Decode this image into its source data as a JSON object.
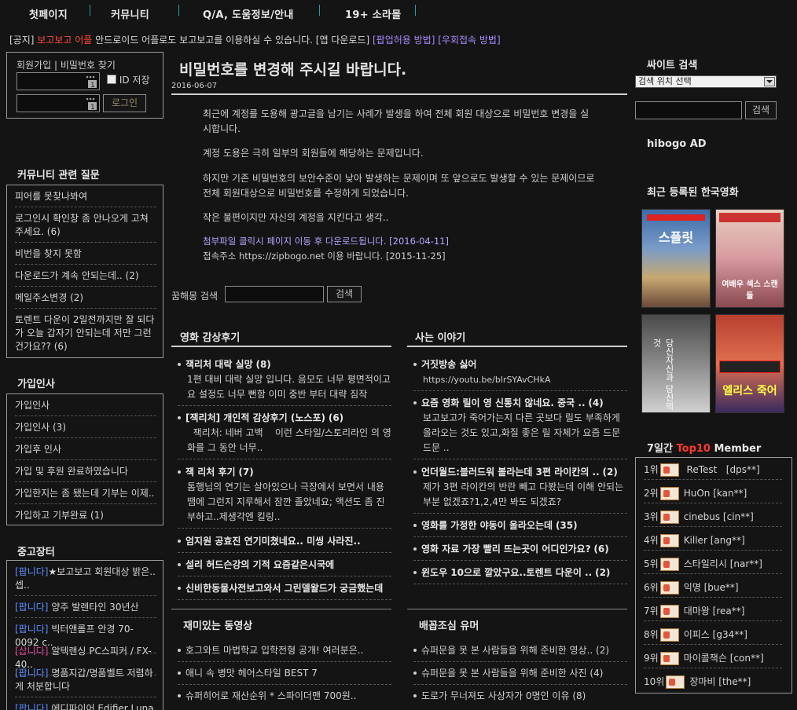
{
  "nav": {
    "items": [
      "첫페이지",
      "커뮤니티",
      "Q/A, 도움정보/안내",
      "19+ 소라몰"
    ]
  },
  "notice": {
    "prefix": "[공지]",
    "highlight": "보고보고 어플",
    "text": " 안드로이드 어플로도 보고보고를 이용하실 수 있습니다. [앱 다운로드] ",
    "link1": "[팝업허용 방법]",
    "link2": "[우회접속 방법]"
  },
  "login": {
    "signup": "회원가입",
    "divider": "|",
    "find_pw": "비밀번호 찾기",
    "save_id": "ID 저장",
    "login_btn": "로그인"
  },
  "community": {
    "title": "커뮤니티 관련 질문",
    "items": [
      {
        "text": "피어를 못찾나봐여",
        "count": ""
      },
      {
        "text": "로그인시 확인창 좀 안나오게 고쳐주세요.",
        "count": "(6)"
      },
      {
        "text": "비번을 찾지 못함",
        "count": ""
      },
      {
        "text": "다운로드가 계속 안되는데..",
        "count": "(2)"
      },
      {
        "text": "메일주소변경",
        "count": "(2)"
      },
      {
        "text": "토렌트 다운이 2일전까지만 잘 되다가 오늘 갑자기 안되는데 저만 그런건가요??",
        "count": "(6)"
      }
    ]
  },
  "greetings": {
    "title": "가입인사",
    "items": [
      {
        "text": "가입인사",
        "count": ""
      },
      {
        "text": "가입인사",
        "count": "(3)"
      },
      {
        "text": "가입후 인사",
        "count": ""
      },
      {
        "text": "가입 및 후원 완료하였습니다",
        "count": ""
      },
      {
        "text": "가입한지는 좀 됐는데 기부는 이제..",
        "count": ""
      },
      {
        "text": "가입하고 기부완료",
        "count": "(1)"
      }
    ]
  },
  "market": {
    "title": "중고장터",
    "items": [
      {
        "tag": "[팝니다]",
        "text": "★보고보고 회원대상 밝은.. 셉..",
        "tagcolor": "blue"
      },
      {
        "tag": "[팝니다]",
        "text": "양주 발렌타인 30년산",
        "tagcolor": "blue"
      },
      {
        "tag": "[팝니다]",
        "text": "빅터앤롤프 안경 70-0092 c..",
        "tagcolor": "blue"
      },
      {
        "tag": "[삽니다]",
        "text": "알텍랜싱 PC스피커 / FX-40..",
        "tagcolor": "magenta"
      },
      {
        "tag": "[팝니다]",
        "text": "명품지갑/명품벨트 저렴하게 처분합니다",
        "tagcolor": "blue"
      },
      {
        "tag": "[팝니다]",
        "text": "에디파이어 Edifier Luna",
        "tagcolor": "blue"
      }
    ]
  },
  "article": {
    "title": "비밀번호를 변경해 주시길 바랍니다.",
    "date": "2016-06-07",
    "p1": "최근에 계정를 도용해 광고글을 남기는 사례가 발생을 하여 전체 회원 대상으로 비밀번호 변경을 실시합니다.",
    "p2": "계정 도용은 극히 일부의 회원들에 해당하는 문제입니다.",
    "p3": "하지만 기존 비밀번호의 보안수준이 낮아 발생하는 문제이며 또 앞으로도 발생할 수 있는 문제이므로 전체 회원대상으로 비밀번호를 수정하게 되었습니다.",
    "p4": "작은 불편이지만 자신의 계정을 지킨다고 생각..",
    "link": "첨부파일 클릭시 페이지 이동 후 다운로드됩니다. [2016-04-11]",
    "addr": "접속주소 https://zipbogo.net 이용 바랍니다. [2015-11-25]"
  },
  "search_main": {
    "label": "꿈해몽 검색",
    "btn": "검색"
  },
  "reviews": {
    "title": "영화 감상후기",
    "items": [
      {
        "title": "잭리처 대락 실망",
        "count": "(8)",
        "desc": "1편 대비 대락 실망 입니다. 음모도 너무 평면적이고요 설정도 너무 뻔함 이미 중반 부터 대략 짐작"
      },
      {
        "title": "[잭리처] 개인적 감상후기 (노스포)",
        "count": "(6)",
        "desc": "  잭리처: 네버 고백    이런 스타일/스토리라인 의 영화를 그 동안 너무.."
      },
      {
        "title": "잭 리처 후기",
        "count": "(7)",
        "desc": "톰행님의 연기는 살아있으나 극장에서 보면서 내용땜에 그런지 지루해서 잠깐 졸았네요; 액션도 좀 진부하고..제생각엔 킬링.."
      },
      {
        "title": "엄지원 공효진 연기미쳤네요.. 미씽 사라진..",
        "count": "",
        "desc": ""
      },
      {
        "title": "설리 허드슨강의 기적 요즘같은시국에",
        "count": "",
        "desc": ""
      },
      {
        "title": "신비한동물사전보고와서 그린델왈드가 궁금했는데",
        "count": "",
        "desc": ""
      }
    ]
  },
  "life": {
    "title": "사는 이야기",
    "items": [
      {
        "title": "거짓방송 싫어",
        "count": "",
        "desc": "https://youtu.be/blrSYAvCHkA"
      },
      {
        "title": "요즘 영화 릴이 영 신통치 않네요. 중국 ..",
        "count": "(4)",
        "desc": "보고보고가 죽어가는지 다른 곳보다 릴도 부족하게 올라오는 것도 있고,화질 좋은 릴 자체가 요즘 드문드문 .."
      },
      {
        "title": "언더월드:블러드워 볼라는데 3편 라이칸의 ..",
        "count": "(2)",
        "desc": "제가 3편 라이칸의 반란 빼고 다봤는데 이해 안되는부분 없겠죠?1,2,4만 봐도 되겠죠?"
      },
      {
        "title": "영화를 가정한 야동이 올라오는데",
        "count": "(35)",
        "desc": ""
      },
      {
        "title": "영화 자료 가장 빨리 뜨는곳이 어디인가요?",
        "count": "(6)",
        "desc": ""
      },
      {
        "title": "윈도우 10으로 깔았구요..토렌트 다운이 ..",
        "count": "(2)",
        "desc": ""
      }
    ]
  },
  "videos": {
    "title": "재미있는 동영상",
    "items": [
      "호그와트 마법학교 입학전형 공개! 여러분은..",
      "애니 속 병맛 헤어스타일 BEST 7",
      "슈퍼히어로 재산순위 * 스파이더맨 700원.."
    ]
  },
  "humor": {
    "title": "배꼽조심 유머",
    "items": [
      {
        "text": "슈퍼문을 못 본 사람들을 위해 준비한 영상..",
        "count": "(2)"
      },
      {
        "text": "슈퍼문을 못 본 사람들을 위해 준비한 사진",
        "count": "(4)"
      },
      {
        "text": "도로가 무너져도 사상자가 0명인 이유",
        "count": "(8)"
      }
    ]
  },
  "site_search": {
    "title": "싸이트 검색",
    "select": "검색 위치 선택",
    "btn": "검색"
  },
  "ad": {
    "title": "hibogo AD"
  },
  "movies": {
    "title": "최근 등록된 한국영화",
    "posters": [
      "스플릿",
      "여배우 섹스 스캔들",
      "당신자신과 당신의 것",
      "엘리스 죽어"
    ]
  },
  "ranking": {
    "title_a": "7일간 ",
    "title_b": "Top10",
    "title_c": " Member",
    "items": [
      {
        "rank": "1위",
        "name": "ReTest",
        "id": "[dps**]"
      },
      {
        "rank": "2위",
        "name": "HuOn",
        "id": "[kan**]"
      },
      {
        "rank": "3위",
        "name": "cinebus",
        "id": "[cin**]"
      },
      {
        "rank": "4위",
        "name": "Killer",
        "id": "[ang**]"
      },
      {
        "rank": "5위",
        "name": "스타일리시",
        "id": "[nar**]"
      },
      {
        "rank": "6위",
        "name": "익명",
        "id": "[bue**]"
      },
      {
        "rank": "7위",
        "name": "대마왕",
        "id": "[rea**]"
      },
      {
        "rank": "8위",
        "name": "이피스",
        "id": "[g34**]"
      },
      {
        "rank": "9위",
        "name": "마이콜잭슨",
        "id": "[con**]"
      },
      {
        "rank": "10위",
        "name": "장마비",
        "id": "[the**]"
      }
    ]
  }
}
